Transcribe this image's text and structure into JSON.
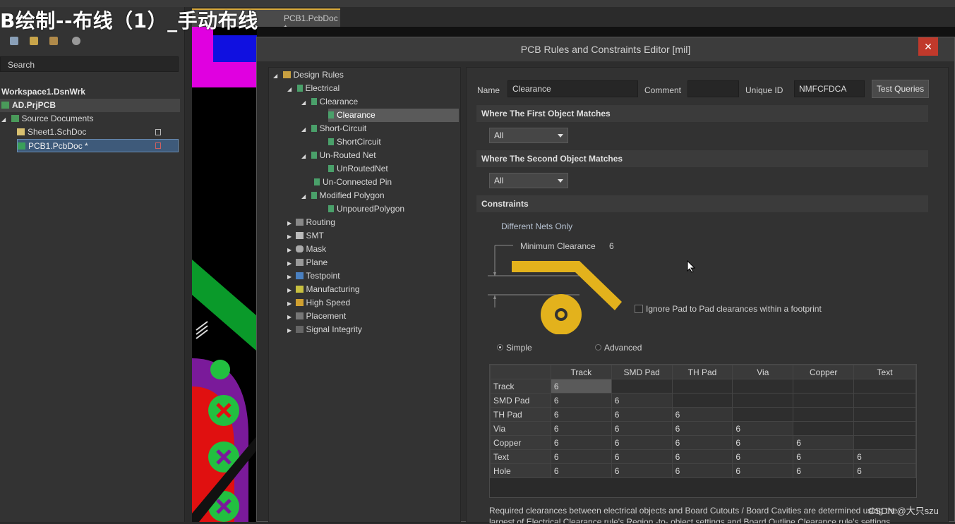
{
  "overlay_title": "B绘制--布线（1）_手动布线",
  "doc_tab": {
    "label": "PCB1.PcbDoc *"
  },
  "projects": {
    "search_placeholder": "Search",
    "workspace": "Workspace1.DsnWrk",
    "project": "AD.PrjPCB",
    "source_documents": "Source Documents",
    "files": [
      "Sheet1.SchDoc",
      "PCB1.PcbDoc *"
    ]
  },
  "dialog": {
    "title": "PCB Rules and Constraints Editor [mil]",
    "close_glyph": "✕"
  },
  "rules_tree": {
    "root": "Design Rules",
    "electrical": "Electrical",
    "clearance_group": "Clearance",
    "clearance_rule": "Clearance",
    "short_circuit_group": "Short-Circuit",
    "short_circuit_rule": "ShortCircuit",
    "unrouted_group": "Un-Routed Net",
    "unrouted_rule": "UnRoutedNet",
    "unconnected_pin": "Un-Connected Pin",
    "modified_polygon": "Modified Polygon",
    "unpoured_polygon": "UnpouredPolygon",
    "categories": [
      "Routing",
      "SMT",
      "Mask",
      "Plane",
      "Testpoint",
      "Manufacturing",
      "High Speed",
      "Placement",
      "Signal Integrity"
    ]
  },
  "rule": {
    "name_label": "Name",
    "name_value": "Clearance",
    "comment_label": "Comment",
    "comment_value": "",
    "uid_label": "Unique ID",
    "uid_value": "NMFCFDCA",
    "test_queries": "Test Queries",
    "first_match_header": "Where The First Object Matches",
    "first_match_value": "All",
    "second_match_header": "Where The Second Object Matches",
    "second_match_value": "All",
    "constraints_header": "Constraints",
    "different_nets": "Different Nets Only",
    "min_clearance_label": "Minimum Clearance",
    "min_clearance_value": "6",
    "ignore_pad_label": "Ignore Pad to Pad clearances within a footprint",
    "mode_simple": "Simple",
    "mode_advanced": "Advanced"
  },
  "clearance_matrix": {
    "columns": [
      "Track",
      "SMD Pad",
      "TH Pad",
      "Via",
      "Copper",
      "Text"
    ],
    "rows": [
      {
        "name": "Track",
        "values": [
          "6",
          "",
          "",
          "",
          "",
          ""
        ]
      },
      {
        "name": "SMD Pad",
        "values": [
          "6",
          "6",
          "",
          "",
          "",
          ""
        ]
      },
      {
        "name": "TH Pad",
        "values": [
          "6",
          "6",
          "6",
          "",
          "",
          ""
        ]
      },
      {
        "name": "Via",
        "values": [
          "6",
          "6",
          "6",
          "6",
          "",
          ""
        ]
      },
      {
        "name": "Copper",
        "values": [
          "6",
          "6",
          "6",
          "6",
          "6",
          ""
        ]
      },
      {
        "name": "Text",
        "values": [
          "6",
          "6",
          "6",
          "6",
          "6",
          "6"
        ]
      },
      {
        "name": "Hole",
        "values": [
          "6",
          "6",
          "6",
          "6",
          "6",
          "6"
        ]
      }
    ]
  },
  "footer_note": "Required clearances between electrical objects and Board Cutouts / Board Cavities are determined using the largest of Electrical Clearance rule's Region -to- object settings and Board Outline Clearance rule's settings",
  "watermark": "CSDN @大只szu",
  "colors": {
    "accent_close": "#c0392b",
    "pad_yellow": "#e3b21c",
    "selection": "#3e5a7a"
  }
}
